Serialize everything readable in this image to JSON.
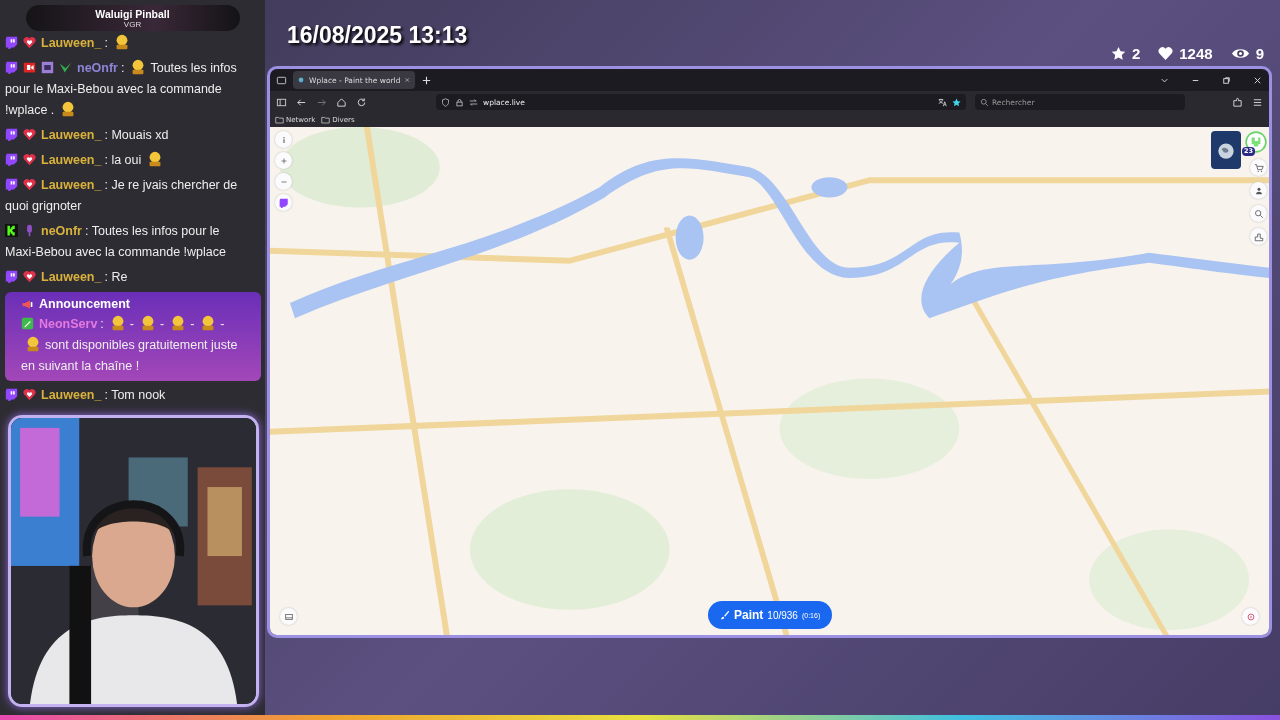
{
  "stream_title": {
    "title": "Waluigi Pinball",
    "subtitle": "VGR"
  },
  "chat": {
    "messages": [
      {
        "kind": "message",
        "badges": [
          {
            "kind": "twitch"
          },
          {
            "kind": "heart"
          }
        ],
        "user": "Lauween_",
        "color": "#d9b23c",
        "segments": [
          {
            "kind": "text",
            "text": ":"
          },
          {
            "kind": "emote"
          }
        ]
      },
      {
        "kind": "message",
        "badges": [
          {
            "kind": "twitch"
          },
          {
            "kind": "camera"
          },
          {
            "kind": "bits"
          },
          {
            "kind": "leaf"
          }
        ],
        "user": "neOnfr",
        "color": "#8c84d8",
        "segments": [
          {
            "kind": "text",
            "text": ":"
          },
          {
            "kind": "emote"
          },
          {
            "kind": "text",
            "text": "Toutes les infos"
          },
          {
            "kind": "text",
            "text": "pour le Maxi-Bebou avec la commande",
            "wrap": true
          },
          {
            "kind": "text",
            "text": "!wplace .",
            "wrap": true
          },
          {
            "kind": "emote"
          }
        ]
      },
      {
        "kind": "message",
        "badges": [
          {
            "kind": "twitch"
          },
          {
            "kind": "heart"
          }
        ],
        "user": "Lauween_",
        "color": "#d9b23c",
        "segments": [
          {
            "kind": "text",
            "text": ": Mouais xd"
          }
        ]
      },
      {
        "kind": "message",
        "badges": [
          {
            "kind": "twitch"
          },
          {
            "kind": "heart"
          }
        ],
        "user": "Lauween_",
        "color": "#d9b23c",
        "segments": [
          {
            "kind": "text",
            "text": ": la oui"
          },
          {
            "kind": "emote"
          }
        ]
      },
      {
        "kind": "message",
        "badges": [
          {
            "kind": "twitch"
          },
          {
            "kind": "heart"
          }
        ],
        "user": "Lauween_",
        "color": "#d9b23c",
        "segments": [
          {
            "kind": "text",
            "text": ": Je re jvais chercher de"
          },
          {
            "kind": "text",
            "text": "quoi grignoter",
            "wrap": true
          }
        ]
      },
      {
        "kind": "message",
        "badges": [
          {
            "kind": "kick"
          },
          {
            "kind": "mic"
          }
        ],
        "user": "neOnfr",
        "color": "#d9b23c",
        "segments": [
          {
            "kind": "text",
            "text": ": Toutes les infos pour le"
          },
          {
            "kind": "text",
            "text": "Maxi-Bebou avec la commande !wplace",
            "wrap": true
          }
        ]
      },
      {
        "kind": "message",
        "badges": [
          {
            "kind": "twitch"
          },
          {
            "kind": "heart"
          }
        ],
        "user": "Lauween_",
        "color": "#d9b23c",
        "segments": [
          {
            "kind": "text",
            "text": ": Re"
          }
        ]
      },
      {
        "kind": "announcement",
        "heading": "Announcement",
        "badges": [
          {
            "kind": "sword"
          }
        ],
        "user": "NeonServ",
        "color": "#e47adf",
        "segments": [
          {
            "kind": "text",
            "text": ":"
          },
          {
            "kind": "emote"
          },
          {
            "kind": "text",
            "text": "-"
          },
          {
            "kind": "emote"
          },
          {
            "kind": "text",
            "text": "-"
          },
          {
            "kind": "emote"
          },
          {
            "kind": "text",
            "text": "-"
          },
          {
            "kind": "emote"
          },
          {
            "kind": "text",
            "text": "-"
          },
          {
            "kind": "emote",
            "wrap": true
          },
          {
            "kind": "text",
            "text": "sont disponibles gratuitement juste"
          },
          {
            "kind": "text",
            "text": "en suivant la chaîne !",
            "wrap": true
          }
        ]
      },
      {
        "kind": "message",
        "badges": [
          {
            "kind": "twitch"
          },
          {
            "kind": "heart"
          }
        ],
        "user": "Lauween_",
        "color": "#d9b23c",
        "segments": [
          {
            "kind": "text",
            "text": ": Tom nook"
          }
        ]
      }
    ]
  },
  "overlay": {
    "datetime": "16/08/2025 13:13",
    "stats": [
      {
        "kind": "star",
        "value": "2"
      },
      {
        "kind": "heart",
        "value": "1248"
      },
      {
        "kind": "eye",
        "value": "9"
      }
    ]
  },
  "browser": {
    "tabs": [
      {
        "title": "Wplace - Paint the world",
        "selected": true
      }
    ],
    "address": "wplace.live",
    "search": {
      "placeholder": "Rechercher"
    },
    "bookmarks": [
      {
        "label": "Network"
      },
      {
        "label": "Divers"
      }
    ]
  },
  "map": {
    "kind": "picture",
    "notification_count": "23",
    "paint_button": {
      "label": "Paint",
      "charges": "10/936",
      "cooldown": "(0:16)"
    }
  }
}
